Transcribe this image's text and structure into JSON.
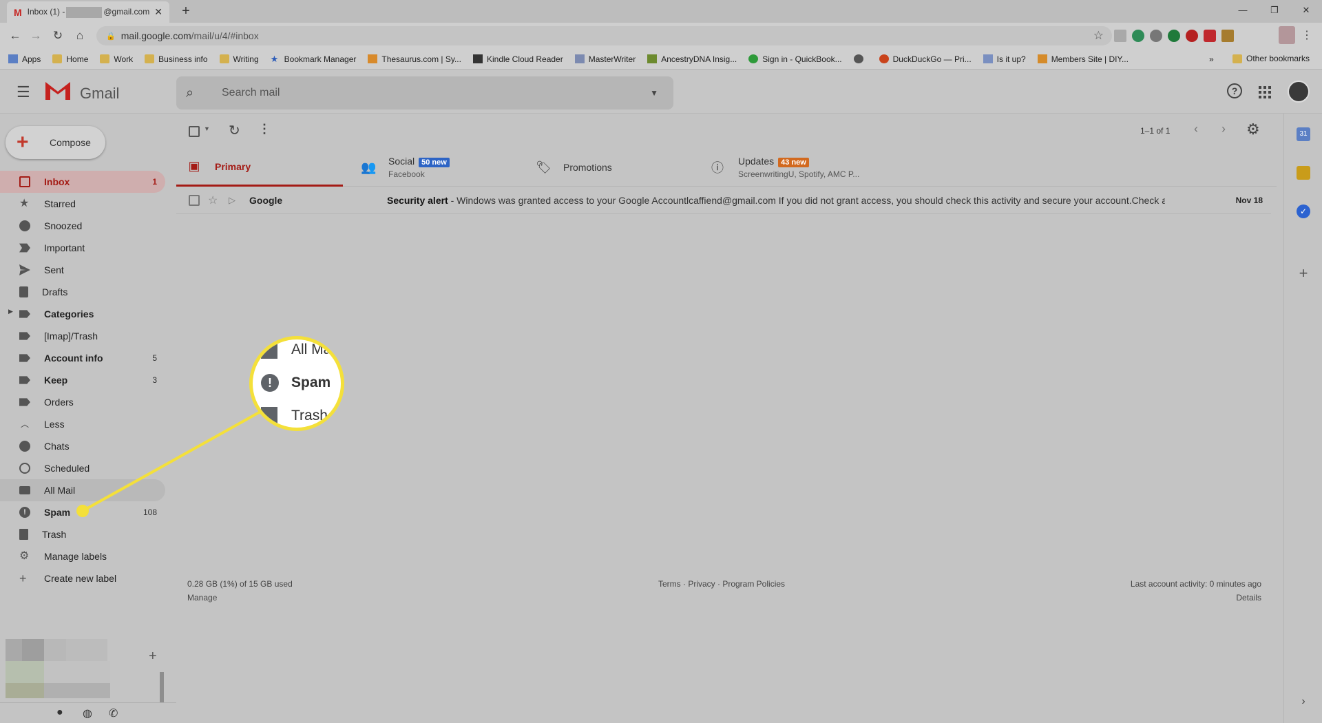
{
  "browser": {
    "tab_title_prefix": "Inbox (1) -",
    "tab_title_suffix": "@gmail.com",
    "url_host": "mail.google.com",
    "url_path": "/mail/u/4/#inbox",
    "bookmarks": [
      {
        "label": "Apps",
        "icon": "apps-grid-icon"
      },
      {
        "label": "Home",
        "icon": "folder-icon"
      },
      {
        "label": "Work",
        "icon": "folder-icon"
      },
      {
        "label": "Business info",
        "icon": "folder-icon"
      },
      {
        "label": "Writing",
        "icon": "folder-icon"
      },
      {
        "label": "Bookmark Manager",
        "icon": "star-icon"
      },
      {
        "label": "Thesaurus.com | Sy...",
        "icon": "site-icon"
      },
      {
        "label": "Kindle Cloud Reader",
        "icon": "kindle-icon"
      },
      {
        "label": "MasterWriter",
        "icon": "site-icon"
      },
      {
        "label": "AncestryDNA Insig...",
        "icon": "site-icon"
      },
      {
        "label": "Sign in - QuickBook...",
        "icon": "quickbooks-icon"
      },
      {
        "label": "",
        "icon": "globe-icon"
      },
      {
        "label": "DuckDuckGo — Pri...",
        "icon": "duckduckgo-icon"
      },
      {
        "label": "Is it up?",
        "icon": "site-icon"
      },
      {
        "label": "Members Site | DIY...",
        "icon": "site-icon"
      }
    ],
    "bookmarks_overflow": "»",
    "other_bookmarks": "Other bookmarks"
  },
  "gmail": {
    "logo_text": "Gmail",
    "search_placeholder": "Search mail",
    "compose_label": "Compose",
    "nav": [
      {
        "label": "Inbox",
        "count": "1",
        "icon": "inbox-icon"
      },
      {
        "label": "Starred",
        "count": "",
        "icon": "star-icon"
      },
      {
        "label": "Snoozed",
        "count": "",
        "icon": "clock-icon"
      },
      {
        "label": "Important",
        "count": "",
        "icon": "important-icon"
      },
      {
        "label": "Sent",
        "count": "",
        "icon": "send-icon"
      },
      {
        "label": "Drafts",
        "count": "",
        "icon": "draft-icon"
      },
      {
        "label": "Categories",
        "count": "",
        "icon": "label-icon"
      },
      {
        "label": "[Imap]/Trash",
        "count": "",
        "icon": "label-icon"
      },
      {
        "label": "Account info",
        "count": "5",
        "icon": "label-icon"
      },
      {
        "label": "Keep",
        "count": "3",
        "icon": "label-icon"
      },
      {
        "label": "Orders",
        "count": "",
        "icon": "label-icon"
      },
      {
        "label": "Less",
        "count": "",
        "icon": "chevron-up-icon"
      },
      {
        "label": "Chats",
        "count": "",
        "icon": "chat-icon"
      },
      {
        "label": "Scheduled",
        "count": "",
        "icon": "scheduled-icon"
      },
      {
        "label": "All Mail",
        "count": "",
        "icon": "all-mail-icon"
      },
      {
        "label": "Spam",
        "count": "108",
        "icon": "spam-icon"
      },
      {
        "label": "Trash",
        "count": "",
        "icon": "trash-icon"
      },
      {
        "label": "Manage labels",
        "count": "",
        "icon": "gear-icon"
      },
      {
        "label": "Create new label",
        "count": "",
        "icon": "plus-icon"
      }
    ],
    "pager": "1–1 of 1",
    "tabs": [
      {
        "name": "Primary",
        "badge": "",
        "sub": ""
      },
      {
        "name": "Social",
        "badge": "50 new",
        "sub": "Facebook"
      },
      {
        "name": "Promotions",
        "badge": "",
        "sub": ""
      },
      {
        "name": "Updates",
        "badge": "43 new",
        "sub": "ScreenwritingU, Spotify, AMC P..."
      }
    ],
    "message": {
      "from": "Google",
      "subject": "Security alert",
      "snippet": " - Windows was granted access to your Google Accountlcaffiend@gmail.com If you did not grant access, you should check this activity and secure your account.Check a",
      "date": "Nov 18"
    },
    "footer": {
      "storage": "0.28 GB (1%) of 15 GB used",
      "manage": "Manage",
      "terms": "Terms · Privacy · Program Policies",
      "activity": "Last account activity: 0 minutes ago",
      "details": "Details"
    }
  },
  "callout": {
    "rows": [
      "All Ma",
      "Spam",
      "Trash"
    ],
    "highlight_color": "#f4e03a"
  },
  "colors": {
    "accent_red": "#a41b15",
    "social_badge": "#2d64c5",
    "updates_badge": "#d2691e"
  }
}
